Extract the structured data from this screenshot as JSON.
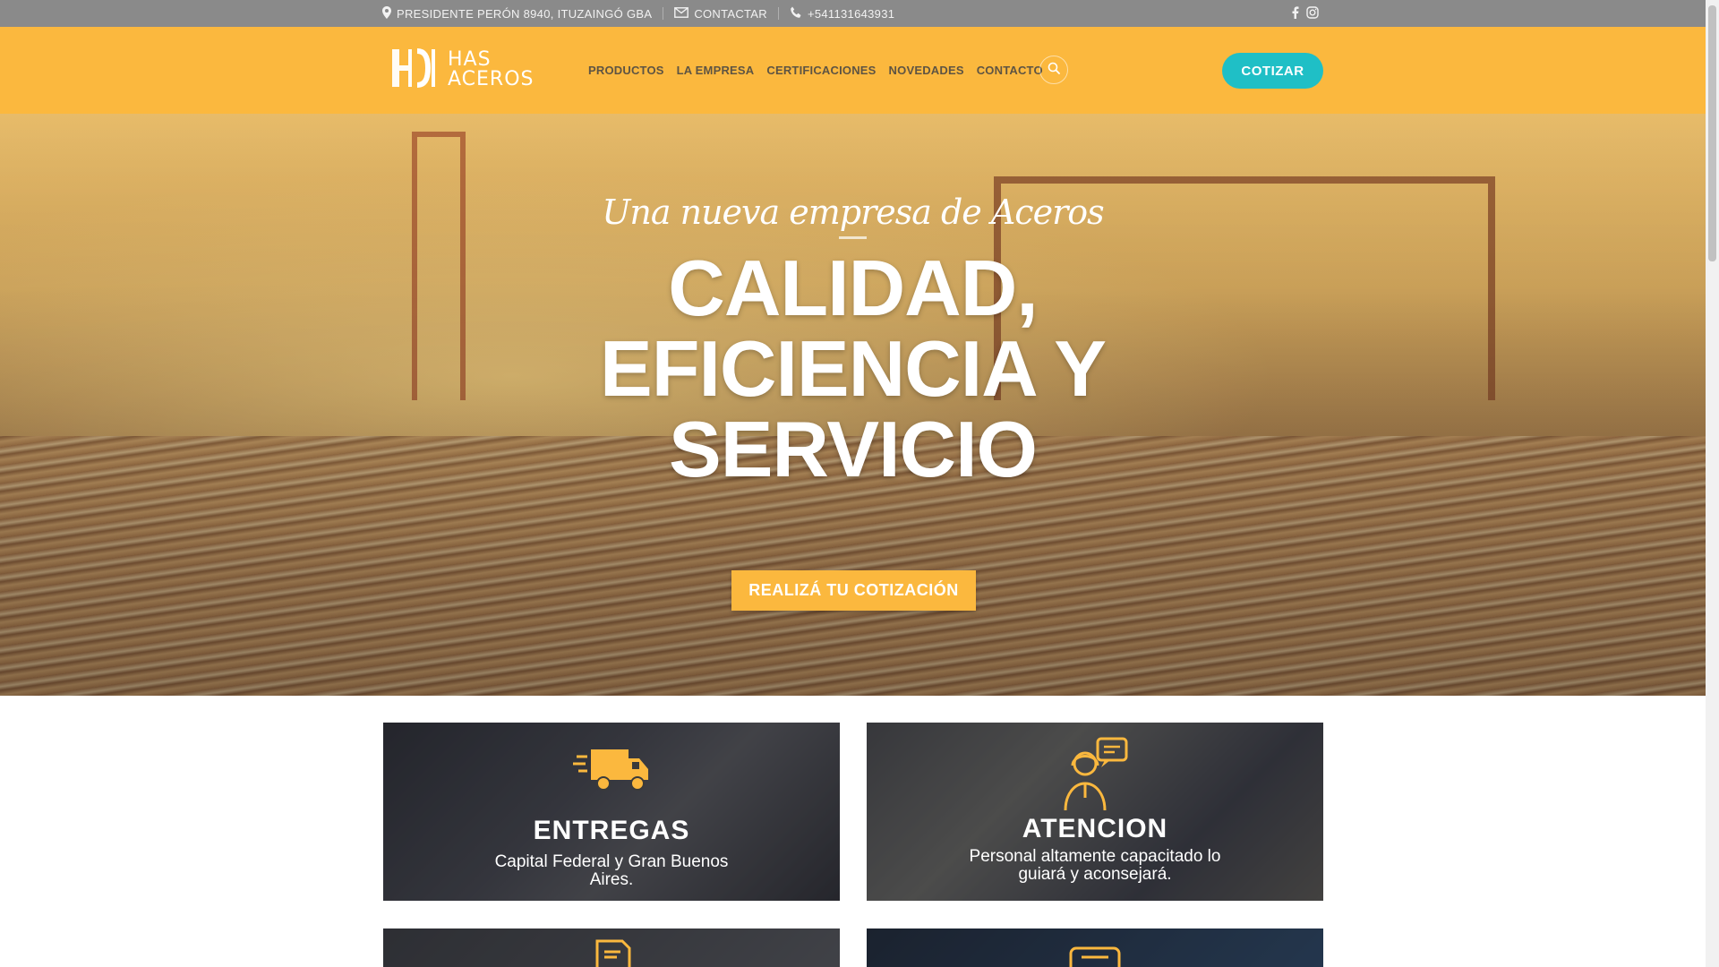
{
  "topbar": {
    "address": "PRESIDENTE PERÓN 8940, ITUZAINGÓ GBA",
    "contact": "CONTACTAR",
    "phone": "+541131643931"
  },
  "header": {
    "logo_text_1": "HAS",
    "logo_text_2": "ACEROS",
    "nav": [
      "PRODUCTOS",
      "LA EMPRESA",
      "CERTIFICACIONES",
      "NOVEDADES",
      "CONTACTO"
    ],
    "cta": "COTIZAR"
  },
  "hero": {
    "subtitle": "Una nueva empresa de Aceros",
    "title_line1": "CALIDAD,",
    "title_line2": "EFICIENCIA Y",
    "title_line3": "SERVICIO",
    "button": "REALIZÁ TU COTIZACIÓN"
  },
  "features": [
    {
      "title": "ENTREGAS",
      "text": "Capital Federal y Gran Buenos Aires.",
      "icon": "truck-icon"
    },
    {
      "title": "ATENCION",
      "text": "Personal altamente capacitado lo guiará y aconsejará.",
      "icon": "support-agent-icon"
    }
  ],
  "colors": {
    "accent": "#fbb83e",
    "cta": "#1fbfc6",
    "topbar": "#8a8a8a"
  }
}
